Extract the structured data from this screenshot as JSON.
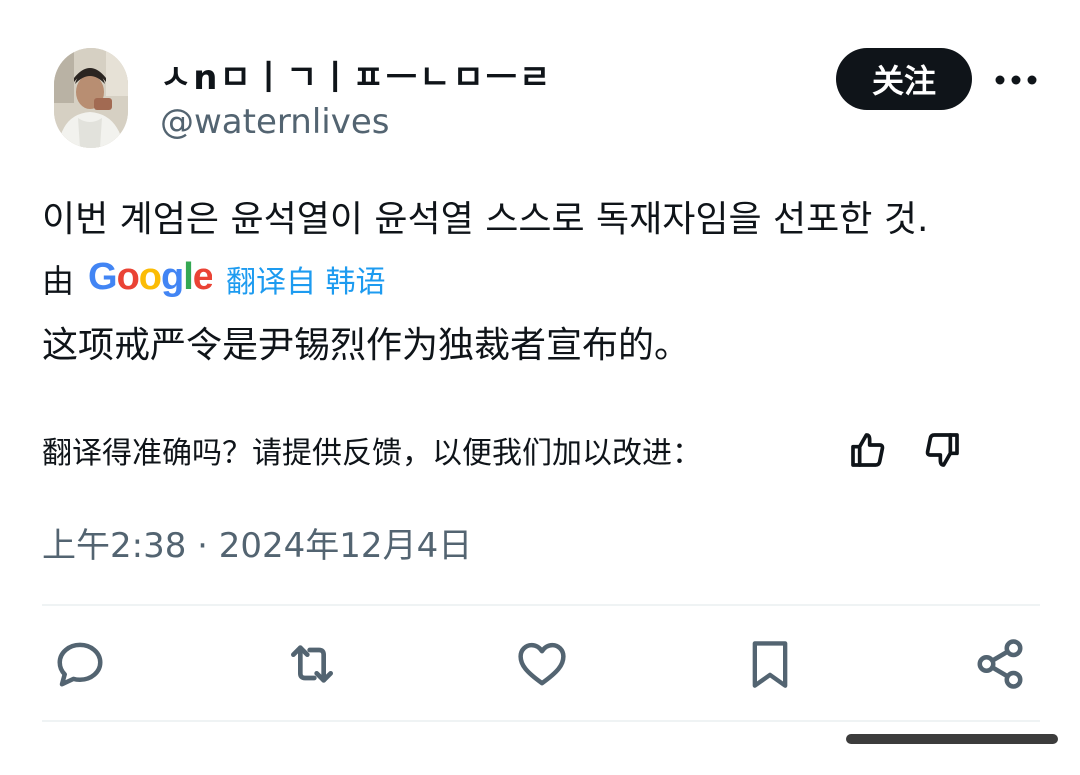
{
  "author": {
    "display_name": "ㅅnㅁㅣㄱㅣㅍㅡㄴㅁㅡㄹ",
    "handle": "@waternlives"
  },
  "follow_button": {
    "label": "关注"
  },
  "tweet": {
    "text": "이번 계엄은 윤석열이 윤석열 스스로 독재자임을 선포한 것.",
    "translated_text": "这项戒严令是尹锡烈作为独裁者宣布的。",
    "timestamp": "上午2:38 · 2024年12月4日"
  },
  "translation": {
    "by_label": "由",
    "provider": "Google",
    "link_label": "翻译自 韩语",
    "feedback_prompt": "翻译得准确吗？请提供反馈，以便我们加以改进："
  },
  "icons": {
    "more": "more-horizontal-icon",
    "thumbs_up": "thumbs-up-icon",
    "thumbs_down": "thumbs-down-icon",
    "reply": "reply-icon",
    "retweet": "retweet-icon",
    "like": "heart-icon",
    "bookmark": "bookmark-icon",
    "share": "share-icon"
  },
  "colors": {
    "text": "#0f1419",
    "secondary": "#536471",
    "link": "#1d9bf0",
    "google_blue": "#4285f4",
    "google_red": "#ea4335",
    "google_yellow": "#fbbc05",
    "google_green": "#34a853"
  }
}
